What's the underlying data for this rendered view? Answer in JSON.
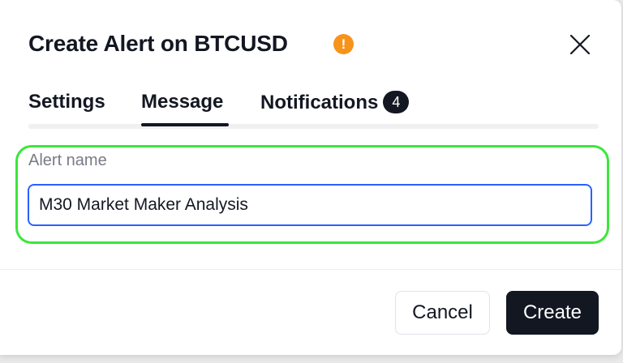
{
  "dialog": {
    "title": "Create Alert on BTCUSD",
    "warning_icon": "exclamation-circle-icon",
    "warning_glyph": "!",
    "close_icon": "close-icon"
  },
  "tabs": [
    {
      "label": "Settings",
      "active": false
    },
    {
      "label": "Message",
      "active": true
    },
    {
      "label": "Notifications",
      "active": false,
      "badge": "4"
    }
  ],
  "form": {
    "alert_name_label": "Alert name",
    "alert_name_value": "M30 Market Maker Analysis"
  },
  "footer": {
    "cancel_label": "Cancel",
    "create_label": "Create"
  },
  "colors": {
    "accent_focus": "#2962ff",
    "warning": "#f7931a",
    "primary_button": "#131722",
    "highlight": "#3ce63c"
  }
}
